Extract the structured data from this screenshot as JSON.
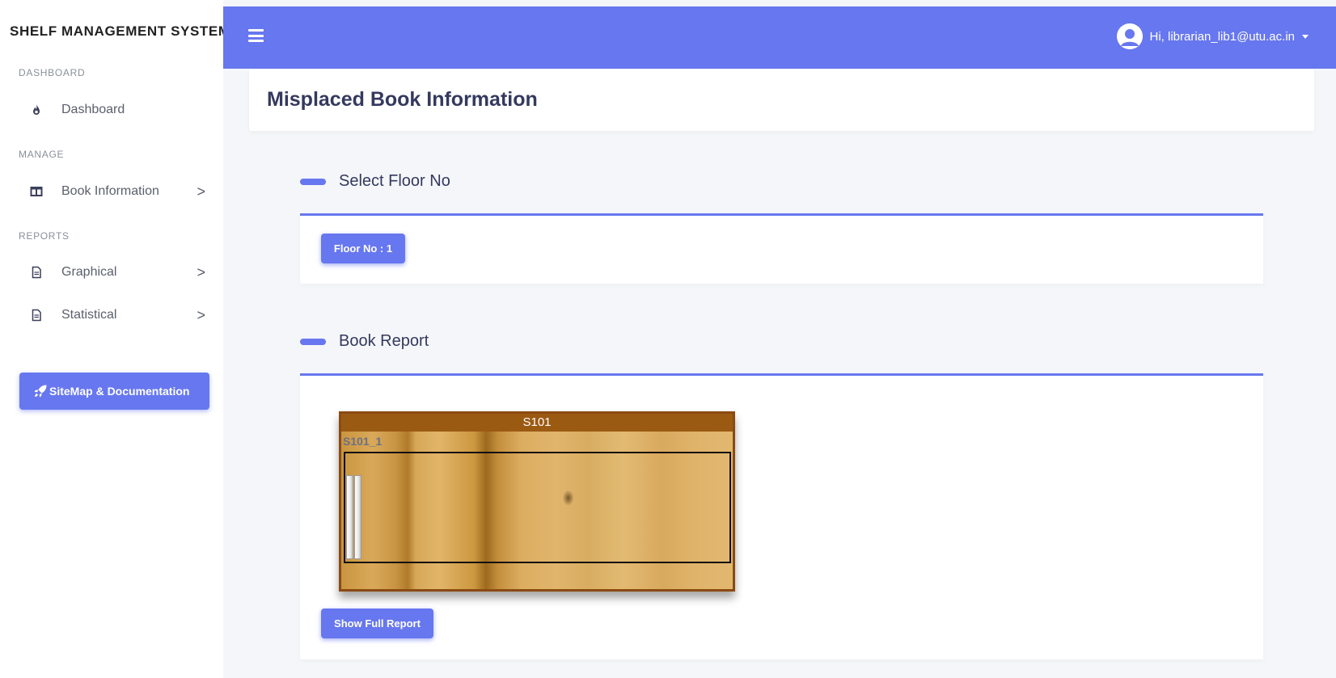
{
  "sidebar": {
    "brand": "SHELF MANAGEMENT SYSTEM",
    "sections": {
      "dashboard": "DASHBOARD",
      "manage": "MANAGE",
      "reports": "REPORTS"
    },
    "items": {
      "dashboard": "Dashboard",
      "book_information": "Book Information",
      "graphical": "Graphical",
      "statistical": "Statistical"
    },
    "chevron": ">",
    "doc_button": "SiteMap & Documentation"
  },
  "topbar": {
    "user_greeting": "Hi, librarian_lib1@utu.ac.in"
  },
  "page": {
    "title": "Misplaced Book Information"
  },
  "floor_section": {
    "heading": "Select Floor No",
    "floor_button": "Floor No : 1"
  },
  "report_section": {
    "heading": "Book Report",
    "shelf_name": "S101",
    "rack_name": "S101_1",
    "show_full_report": "Show Full Report"
  },
  "colors": {
    "primary": "#6777ef",
    "shelf_frame": "#8b4a12"
  },
  "icons": [
    "fire-icon",
    "columns-icon",
    "file-icon",
    "chevron-right-icon",
    "rocket-icon",
    "menu-icon",
    "user-avatar-icon",
    "caret-down-icon"
  ]
}
